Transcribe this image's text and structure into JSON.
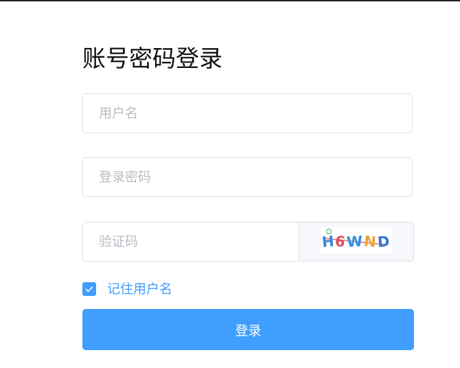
{
  "login": {
    "title": "账号密码登录",
    "username": {
      "value": "",
      "placeholder": "用户名"
    },
    "password": {
      "value": "",
      "placeholder": "登录密码"
    },
    "captcha": {
      "value": "",
      "placeholder": "验证码",
      "image_chars": [
        "H",
        "6",
        "W",
        "N",
        "D"
      ]
    },
    "remember": {
      "label": "记住用户名",
      "checked": true
    },
    "submit_label": "登录"
  },
  "colors": {
    "primary": "#409eff",
    "border": "#dcdfe6",
    "placeholder": "#b9bcc3",
    "title": "#111111"
  }
}
